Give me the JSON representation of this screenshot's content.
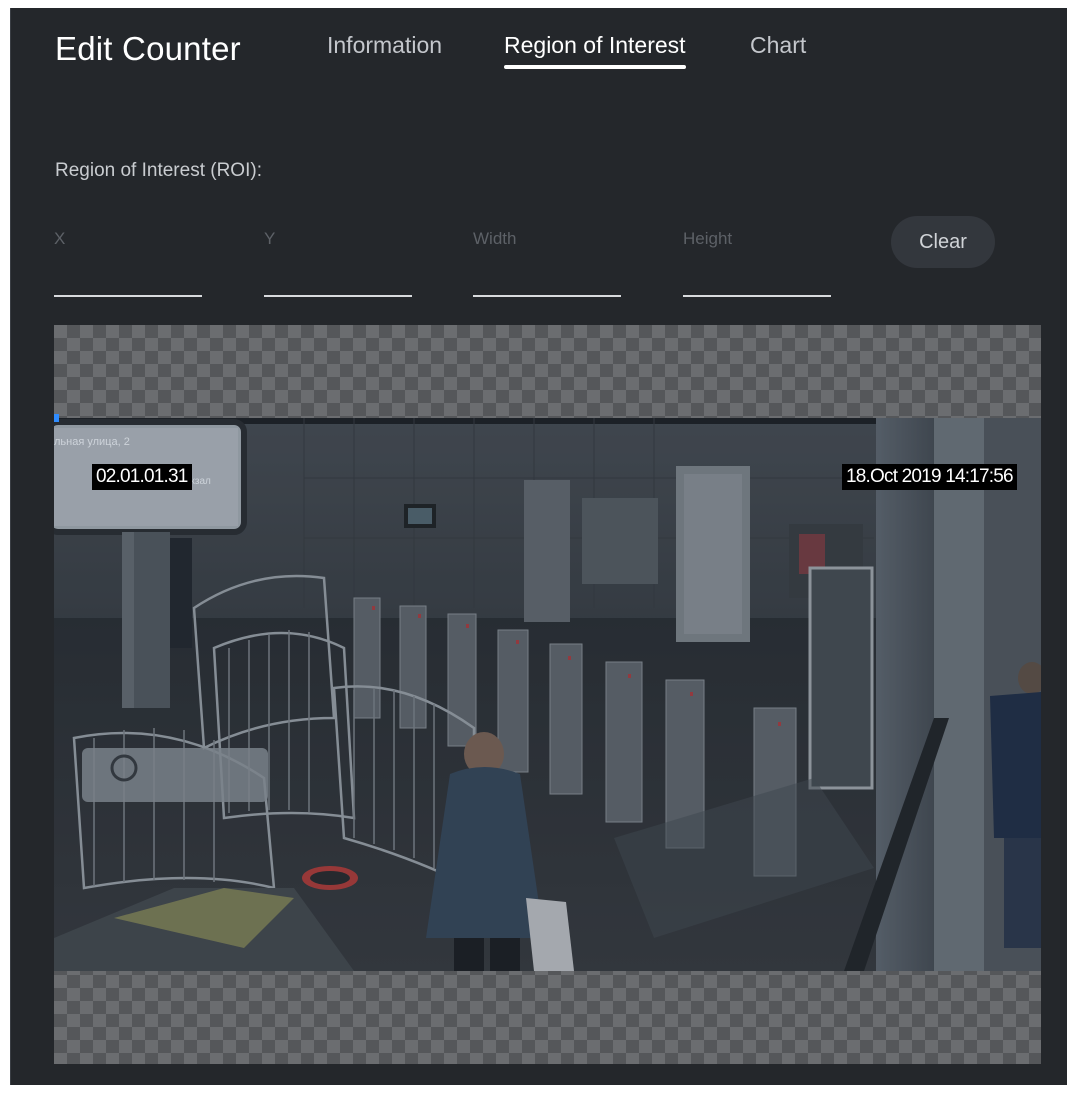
{
  "header": {
    "title": "Edit Counter",
    "tabs": [
      {
        "label": "Information",
        "active": false
      },
      {
        "label": "Region of Interest",
        "active": true
      },
      {
        "label": "Chart",
        "active": false
      }
    ]
  },
  "roi": {
    "section_label": "Region of Interest (ROI):",
    "fields": {
      "x": {
        "placeholder": "X",
        "value": ""
      },
      "y": {
        "placeholder": "Y",
        "value": ""
      },
      "width": {
        "placeholder": "Width",
        "value": ""
      },
      "height": {
        "placeholder": "Height",
        "value": ""
      }
    },
    "clear_label": "Clear"
  },
  "camera": {
    "camera_id": "02.01.01.31",
    "timestamp": "18.Oct 2019  14:17:56",
    "sign_line1": "льная улица, 2",
    "sign_line2": "Северный речной вокзал"
  },
  "colors": {
    "panel": "#24272b",
    "accent_handle": "#2f8cff",
    "text_primary": "#ffffff",
    "text_muted": "#c4c7cc"
  }
}
